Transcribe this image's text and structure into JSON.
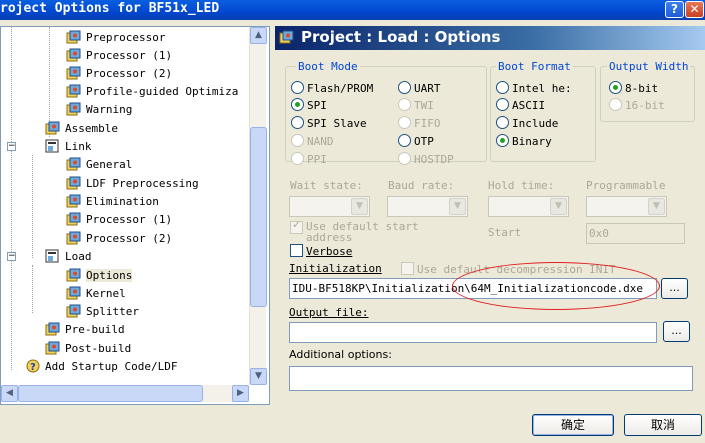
{
  "window": {
    "title": "roject Options for BF51x_LED",
    "help": "?",
    "close": "✕"
  },
  "tree": {
    "items": [
      {
        "label": "Preprocessor",
        "icon": "gear-icon"
      },
      {
        "label": "Processor (1)",
        "icon": "gear-icon"
      },
      {
        "label": "Processor (2)",
        "icon": "gear-icon"
      },
      {
        "label": "Profile-guided Optimiza",
        "icon": "gear-icon"
      },
      {
        "label": "Warning",
        "icon": "gear-icon"
      },
      {
        "label": "Assemble",
        "icon": "gear-icon"
      },
      {
        "label": "Link",
        "icon": "folder-icon"
      },
      {
        "label": "General",
        "icon": "gear-icon"
      },
      {
        "label": "LDF Preprocessing",
        "icon": "gear-icon"
      },
      {
        "label": "Elimination",
        "icon": "gear-icon"
      },
      {
        "label": "Processor (1)",
        "icon": "gear-icon"
      },
      {
        "label": "Processor (2)",
        "icon": "gear-icon"
      },
      {
        "label": "Load",
        "icon": "folder-icon"
      },
      {
        "label": "Options",
        "icon": "gear-icon"
      },
      {
        "label": "Kernel",
        "icon": "gear-icon"
      },
      {
        "label": "Splitter",
        "icon": "gear-icon"
      },
      {
        "label": "Pre-build",
        "icon": "gear-icon"
      },
      {
        "label": "Post-build",
        "icon": "gear-icon"
      },
      {
        "label": "Add Startup Code/LDF",
        "icon": "wizard-icon"
      }
    ],
    "expander_minus": "−"
  },
  "panel": {
    "title": "Project : Load : Options",
    "boot_mode": {
      "legend": "Boot Mode",
      "options": [
        "Flash/PROM",
        "SPI",
        "SPI Slave",
        "NAND",
        "PPI",
        "UART",
        "TWI",
        "FIFO",
        "OTP",
        "HOSTDP"
      ]
    },
    "boot_format": {
      "legend": "Boot Format",
      "options": [
        "Intel he:",
        "ASCII",
        "Include",
        "Binary"
      ]
    },
    "output_width": {
      "legend": "Output Width",
      "options": [
        "8-bit",
        "16-bit"
      ]
    },
    "wait_state": "Wait state:",
    "baud_rate": "Baud rate:",
    "hold_time": "Hold time:",
    "programmable": "Programmable",
    "use_default_start": "Use default start address",
    "start_label": "Start",
    "start_value": "0x0",
    "verbose": "Verbose",
    "initialization_label": "Initialization",
    "use_default_decompression": "Use default decompression INIT",
    "initialization_value": "IDU-BF518KP\\Initialization\\64M_Initializationcode.dxe",
    "output_file_label": "Output file:",
    "output_file_value": "",
    "additional_options_label": "Additional options:",
    "additional_options_value": "",
    "browse": "..."
  },
  "buttons": {
    "ok": "确定",
    "cancel": "取消"
  },
  "colors": {
    "title_bar": "#0047CF",
    "header_gradient_start": "#0A246A",
    "legend_text": "#0046D5",
    "annotation": "#E0211F",
    "selected_radio": "#21A121"
  }
}
